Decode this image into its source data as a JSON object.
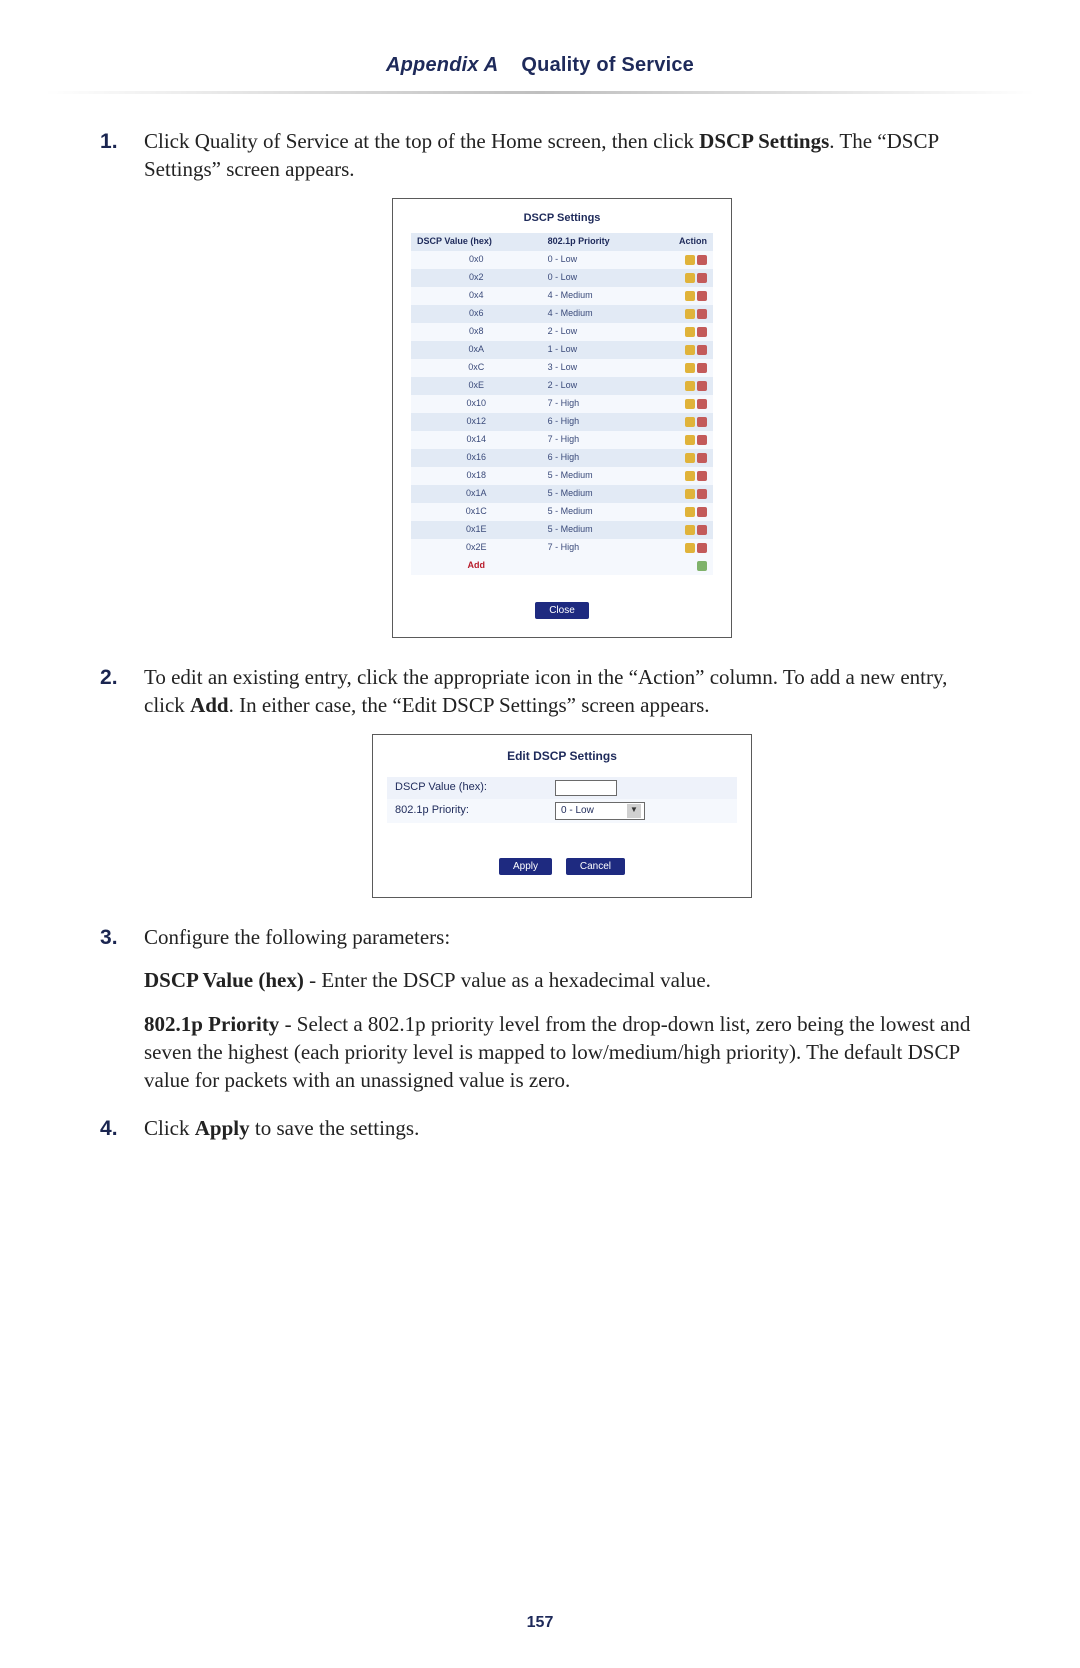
{
  "header": {
    "appendix": "Appendix A",
    "title": "Quality of Service"
  },
  "steps": {
    "s1_a": "Click Quality of Service at the top of the Home screen, then click ",
    "s1_b": "DSCP Settings",
    "s1_c": ". The “",
    "s1_d": "DSCP",
    "s1_e": " Settings” screen appears.",
    "s2_a": "To edit an existing entry, click the appropriate icon in the “Action” column. To add a new entry, click ",
    "s2_b": "Add",
    "s2_c": ". In either case, the “Edit DSCP Settings” screen appears.",
    "s3": "Configure the following parameters:",
    "s4_a": "Click ",
    "s4_b": "Apply",
    "s4_c": " to save the settings."
  },
  "params": {
    "p1_b": "DSCP Value (hex)",
    "p1_a": " - Enter the ",
    "p1_c": "DSCP",
    "p1_d": " value as a hexadecimal value.",
    "p2_b": "802.1p Priority",
    "p2_a": " - Select a 802.1p priority level from the drop-down list, zero being the lowest and seven the highest (each priority level is mapped to low/medium/high priority). The default ",
    "p2_c": "DSCP",
    "p2_d": " value for packets with an unassigned value is zero."
  },
  "dscp_panel": {
    "title": "DSCP Settings",
    "cols": {
      "c1": "DSCP Value (hex)",
      "c2": "802.1p Priority",
      "c3": "Action"
    },
    "rows": [
      {
        "v": "0x0",
        "p": "0 - Low"
      },
      {
        "v": "0x2",
        "p": "0 - Low"
      },
      {
        "v": "0x4",
        "p": "4 - Medium"
      },
      {
        "v": "0x6",
        "p": "4 - Medium"
      },
      {
        "v": "0x8",
        "p": "2 - Low"
      },
      {
        "v": "0xA",
        "p": "1 - Low"
      },
      {
        "v": "0xC",
        "p": "3 - Low"
      },
      {
        "v": "0xE",
        "p": "2 - Low"
      },
      {
        "v": "0x10",
        "p": "7 - High"
      },
      {
        "v": "0x12",
        "p": "6 - High"
      },
      {
        "v": "0x14",
        "p": "7 - High"
      },
      {
        "v": "0x16",
        "p": "6 - High"
      },
      {
        "v": "0x18",
        "p": "5 - Medium"
      },
      {
        "v": "0x1A",
        "p": "5 - Medium"
      },
      {
        "v": "0x1C",
        "p": "5 - Medium"
      },
      {
        "v": "0x1E",
        "p": "5 - Medium"
      },
      {
        "v": "0x2E",
        "p": "7 - High"
      }
    ],
    "add": "Add",
    "close": "Close"
  },
  "edit_panel": {
    "title": "Edit DSCP Settings",
    "row1": "DSCP Value (hex):",
    "row2": "802.1p Priority:",
    "select_value": "0 - Low",
    "apply": "Apply",
    "cancel": "Cancel"
  },
  "page_number": "157"
}
